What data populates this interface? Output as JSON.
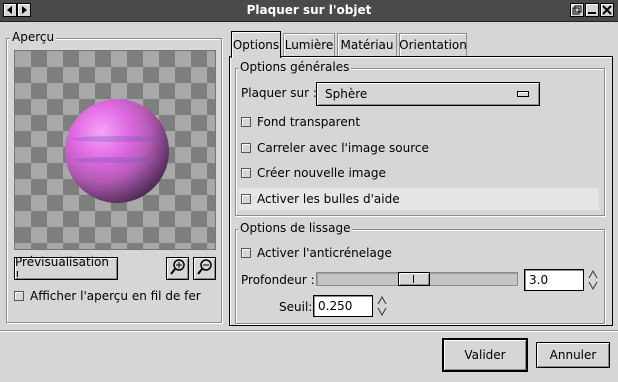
{
  "window": {
    "title": "Plaquer sur l'objet"
  },
  "preview_panel": {
    "label": "Aperçu",
    "preview_button": "Prévisualisation !",
    "zoom_in_icon": "zoom-in-icon",
    "zoom_out_icon": "zoom-out-icon",
    "wireframe_label": "Afficher l'aperçu en fil de fer",
    "wireframe_checked": false
  },
  "tabs": [
    {
      "label": "Options",
      "active": true
    },
    {
      "label": "Lumière",
      "active": false
    },
    {
      "label": "Matériau",
      "active": false
    },
    {
      "label": "Orientation",
      "active": false
    }
  ],
  "general_options": {
    "label": "Options générales",
    "map_on_label": "Plaquer sur :",
    "map_on_value": "Sphère",
    "checkboxes": [
      {
        "label": "Fond transparent",
        "checked": false
      },
      {
        "label": "Carreler avec l'image source",
        "checked": false
      },
      {
        "label": "Créer nouvelle image",
        "checked": false
      },
      {
        "label": "Activer les bulles d'aide",
        "checked": false
      }
    ]
  },
  "smoothing_options": {
    "label": "Options de lissage",
    "antialias_label": "Activer l'anticrénelage",
    "antialias_checked": false,
    "depth_label": "Profondeur :",
    "depth_value": "3.0",
    "depth_slider_fraction": 0.5,
    "threshold_label": "Seuil:",
    "threshold_value": "0.250"
  },
  "buttons": {
    "ok": "Valider",
    "cancel": "Annuler"
  }
}
